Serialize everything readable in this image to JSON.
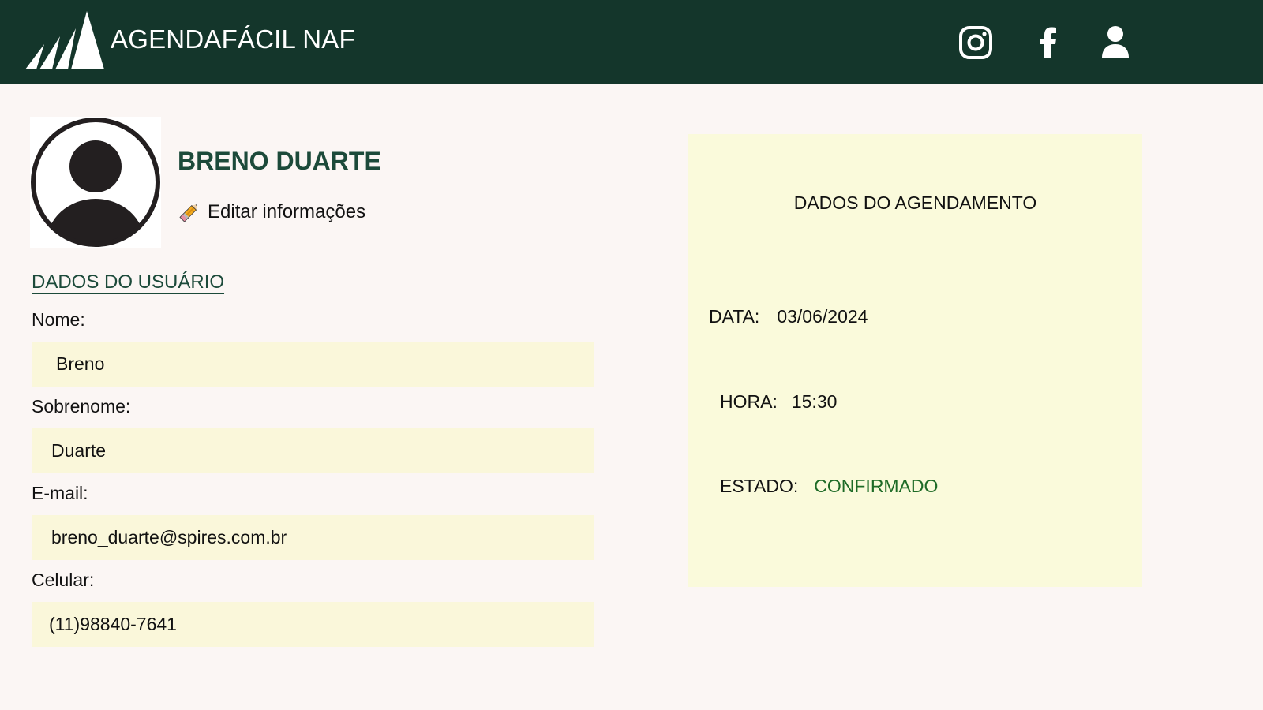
{
  "header": {
    "brand": "AGENDAFÁCIL NAF",
    "icons": [
      "logo-mountains-icon",
      "instagram-icon",
      "facebook-icon",
      "user-account-icon"
    ]
  },
  "profile": {
    "name": "BRENO DUARTE",
    "edit_label": "Editar informações"
  },
  "user_data": {
    "section_title": "DADOS DO USUÁRIO",
    "fields": [
      {
        "label": "Nome:",
        "value": "Breno"
      },
      {
        "label": "Sobrenome:",
        "value": "Duarte"
      },
      {
        "label": "E-mail:",
        "value": "breno_duarte@spires.com.br"
      },
      {
        "label": "Celular:",
        "value": "(11)98840-7641"
      }
    ]
  },
  "appointment": {
    "title": "DADOS DO AGENDAMENTO",
    "date_label": "DATA:",
    "date_value": "03/06/2024",
    "time_label": "HORA:",
    "time_value": "15:30",
    "status_label": "ESTADO:",
    "status_value": "CONFIRMADO"
  },
  "colors": {
    "header_bg": "#14362b",
    "page_bg": "#fbf6f4",
    "field_bg": "#faf7da",
    "panel_bg": "#fafadb",
    "accent_green": "#1c4a3a",
    "status_green": "#1d6a26"
  }
}
